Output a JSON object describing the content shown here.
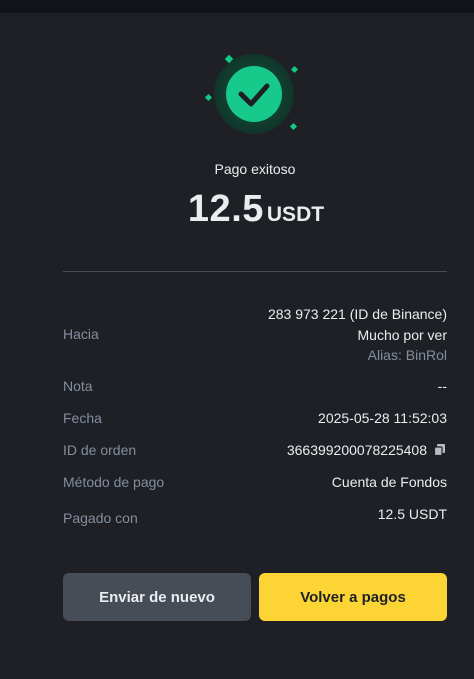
{
  "status": {
    "title": "Pago exitoso"
  },
  "amount": {
    "value": "12.5",
    "currency": "USDT"
  },
  "details": {
    "to_label": "Hacia",
    "to_id": "283 973 221 (ID de Binance)",
    "to_name": "Mucho por ver",
    "to_alias": "Alias: BinRol",
    "note_label": "Nota",
    "note_value": "--",
    "date_label": "Fecha",
    "date_value": "2025-05-28 11:52:03",
    "order_label": "ID de orden",
    "order_value": "366399200078225408",
    "method_label": "Método de pago",
    "method_value": "Cuenta de Fondos",
    "paid_label": "Pagado con",
    "paid_value": "12.5 USDT"
  },
  "buttons": {
    "send_again": "Enviar de nuevo",
    "back_to_payments": "Volver a pagos"
  },
  "icons": {
    "success": "check-circle-icon",
    "copy": "copy-icon"
  },
  "colors": {
    "background": "#1e2026",
    "success": "#0ecb81",
    "primary": "#fcd535",
    "muted": "#848e9c"
  }
}
